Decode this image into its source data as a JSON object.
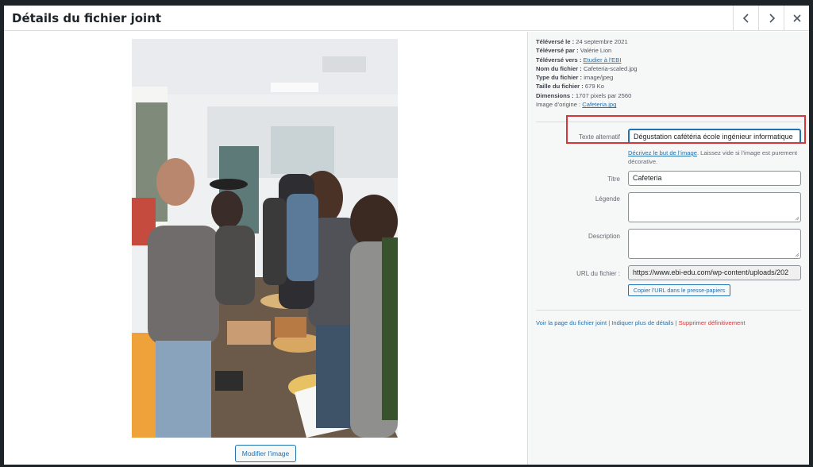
{
  "header": {
    "title": "Détails du fichier joint",
    "prev_icon": "chevron-left-icon",
    "next_icon": "chevron-right-icon",
    "close_icon": "close-icon"
  },
  "image_panel": {
    "edit_button_label": "Modifier l’image"
  },
  "meta": {
    "uploaded_on_label": "Téléversé le :",
    "uploaded_on_value": "24 septembre 2021",
    "uploaded_by_label": "Téléversé par :",
    "uploaded_by_value": "Valérie Lion",
    "uploaded_to_label": "Téléversé vers :",
    "uploaded_to_value": "Etudier à l'EBI",
    "file_name_label": "Nom du fichier :",
    "file_name_value": "Cafeteria-scaled.jpg",
    "file_type_label": "Type du fichier :",
    "file_type_value": "image/jpeg",
    "file_size_label": "Taille du fichier :",
    "file_size_value": "679 Ko",
    "dimensions_label": "Dimensions :",
    "dimensions_value": "1707 pixels par 2560",
    "original_label": "Image d’origine :",
    "original_value": "Cafeteria.jpg"
  },
  "fields": {
    "alt_label": "Texte alternatif",
    "alt_value": "Dégustation cafétéria école ingénieur informatique",
    "alt_help_link": "Décrivez le but de l’image",
    "alt_help_text": ". Laissez vide si l’image est purement décorative.",
    "title_label": "Titre",
    "title_value": "Cafeteria",
    "caption_label": "Légende",
    "caption_value": "",
    "description_label": "Description",
    "description_value": "",
    "url_label": "URL du fichier :",
    "url_value": "https://www.ebi-edu.com/wp-content/uploads/202",
    "copy_url_label": "Copier l’URL dans le presse-papiers"
  },
  "actions": {
    "view_page": "Voir la page du fichier joint",
    "separator": " | ",
    "more_details": "Indiquer plus de détails",
    "delete": "Supprimer définitivement"
  },
  "colors": {
    "accent": "#2271b1",
    "danger": "#d63638",
    "highlight_box": "#d63638"
  }
}
